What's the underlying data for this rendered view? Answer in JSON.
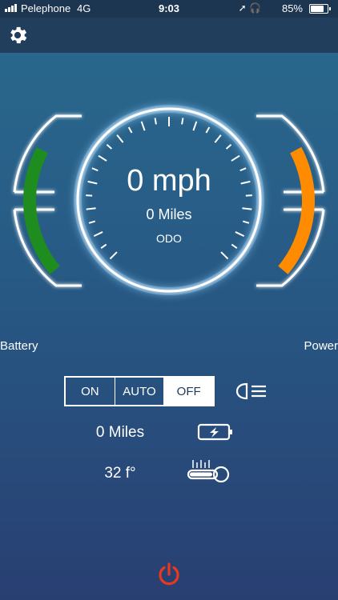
{
  "status": {
    "carrier": "Pelephone",
    "network": "4G",
    "time": "9:03",
    "battery_pct": "85%",
    "battery_level": 0.85
  },
  "toolbar": {
    "settings_icon": "gear-icon"
  },
  "gauge": {
    "speed": "0 mph",
    "miles": "0 Miles",
    "odo": "ODO",
    "battery_label": "Battery",
    "power_label": "Power",
    "battery_level": 0.85,
    "power_level": 0.85,
    "battery_color": "#1f8c1f",
    "power_color": "#ff8c00",
    "ring_glow": "#a8d8ff"
  },
  "lights": {
    "options": [
      "ON",
      "AUTO",
      "OFF"
    ],
    "selected": "OFF",
    "icon": "headlight-icon"
  },
  "info": {
    "range": "0 Miles",
    "range_icon": "battery-charging-icon",
    "temperature": "32 f°",
    "temperature_icon": "thermometer-icon"
  },
  "power": {
    "icon": "power-icon",
    "color": "#e8391f"
  }
}
